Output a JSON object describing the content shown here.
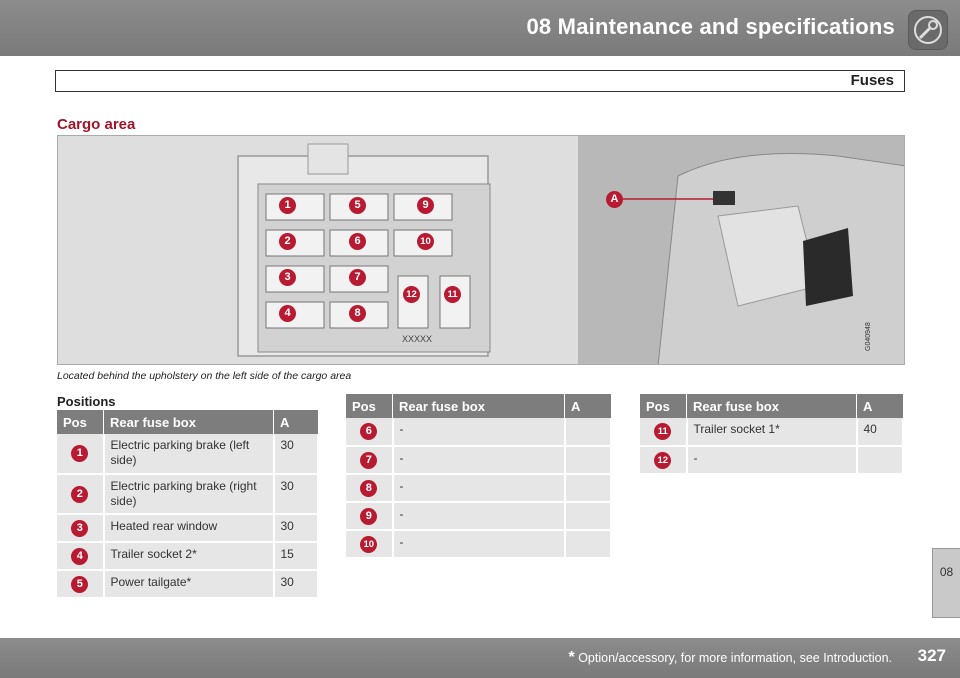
{
  "header": {
    "title": "08 Maintenance and specifications"
  },
  "section": {
    "label": "Fuses"
  },
  "subheading": "Cargo area",
  "figure": {
    "callout_marker": "A",
    "label_box": "XXXXX",
    "image_code": "G040948",
    "fuse_numbers": [
      "1",
      "2",
      "3",
      "4",
      "5",
      "6",
      "7",
      "8",
      "9",
      "10",
      "11",
      "12"
    ]
  },
  "caption": "Located behind the upholstery on the left side of the cargo area",
  "positions_label": "Positions",
  "table_headers": {
    "pos": "Pos",
    "box": "Rear fuse box",
    "amp": "A"
  },
  "table1": [
    {
      "pos": "1",
      "desc": "Electric parking brake (left side)",
      "amp": "30"
    },
    {
      "pos": "2",
      "desc": "Electric parking brake (right side)",
      "amp": "30"
    },
    {
      "pos": "3",
      "desc": "Heated rear window",
      "amp": "30"
    },
    {
      "pos": "4",
      "desc": "Trailer socket 2*",
      "amp": "15"
    },
    {
      "pos": "5",
      "desc": "Power tailgate*",
      "amp": "30"
    }
  ],
  "table2": [
    {
      "pos": "6",
      "desc": "-",
      "amp": ""
    },
    {
      "pos": "7",
      "desc": "-",
      "amp": ""
    },
    {
      "pos": "8",
      "desc": "-",
      "amp": ""
    },
    {
      "pos": "9",
      "desc": "-",
      "amp": ""
    },
    {
      "pos": "10",
      "desc": "-",
      "amp": ""
    }
  ],
  "table3": [
    {
      "pos": "11",
      "desc": "Trailer socket 1*",
      "amp": "40"
    },
    {
      "pos": "12",
      "desc": "-",
      "amp": ""
    }
  ],
  "side_tab": "08",
  "footer": {
    "asterisk": "*",
    "note": "Option/accessory, for more information, see Introduction.",
    "page": "327"
  },
  "colors": {
    "accent": "#b81a32",
    "header_bg": "#808080"
  }
}
